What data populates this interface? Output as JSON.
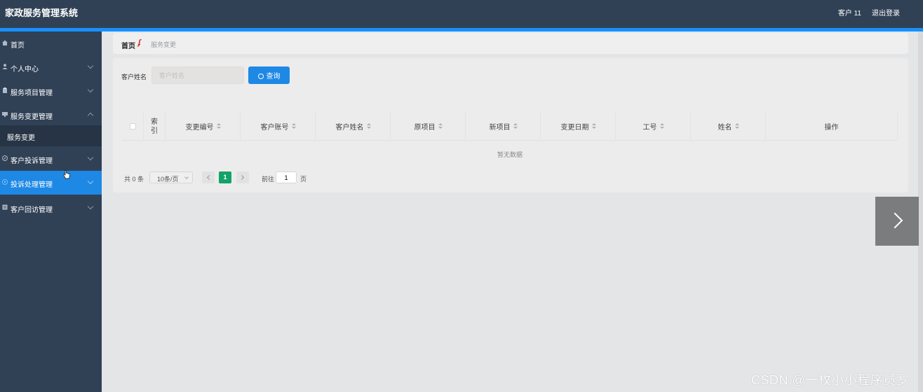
{
  "header": {
    "title": "家政服务管理系统",
    "user": "客户 11",
    "logout": "退出登录"
  },
  "sidebar": {
    "items": [
      {
        "label": "首页"
      },
      {
        "label": "个人中心"
      },
      {
        "label": "服务项目管理"
      },
      {
        "label": "服务变更管理"
      },
      {
        "label": "客户投诉管理"
      },
      {
        "label": "投诉处理管理"
      },
      {
        "label": "客户回访管理"
      }
    ],
    "sub_item": "服务变更"
  },
  "breadcrumb": {
    "home": "首页",
    "current": "服务变更"
  },
  "search": {
    "label": "客户姓名",
    "placeholder": "客户姓名",
    "button": "查询"
  },
  "table": {
    "columns": [
      "索引",
      "变更编号",
      "客户账号",
      "客户姓名",
      "原项目",
      "新项目",
      "变更日期",
      "工号",
      "姓名",
      "操作"
    ],
    "empty_text": "暂无数据"
  },
  "pagination": {
    "total": "共 0 条",
    "page_size": "10条/页",
    "current_page": "1",
    "goto_label": "前往",
    "goto_value": "1",
    "page_unit": "页"
  },
  "watermark": "CSDN @一枚小小程序员罗",
  "colors": {
    "header_bg": "#304156",
    "accent": "#1e88e5",
    "page_active": "#13a26a"
  }
}
